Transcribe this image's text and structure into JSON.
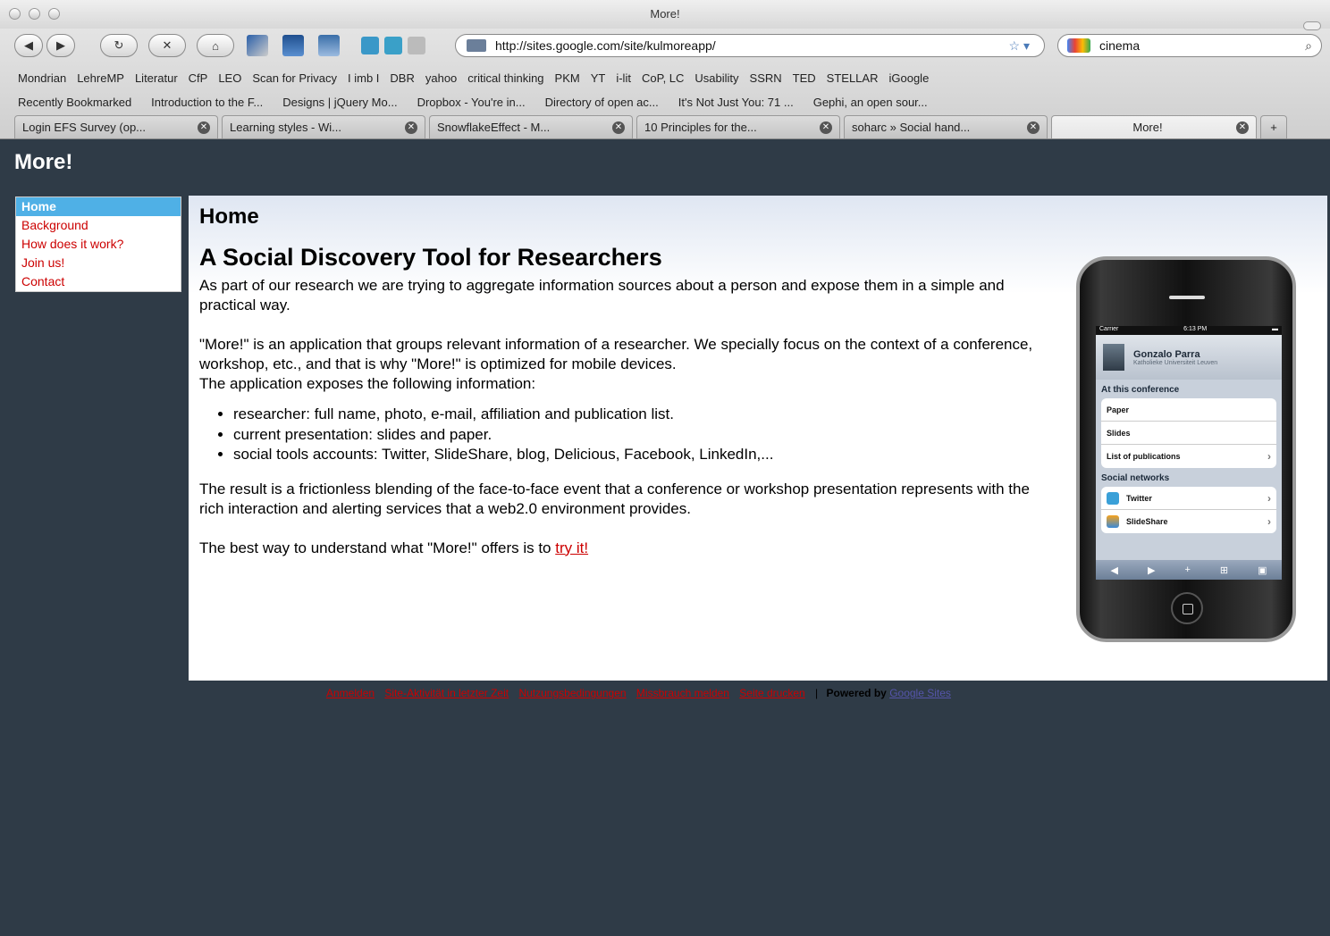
{
  "window": {
    "title": "More!"
  },
  "nav": {
    "url": "http://sites.google.com/site/kulmoreapp/",
    "search": "cinema"
  },
  "bookmarks": [
    "Mondrian",
    "LehreMP",
    "Literatur",
    "CfP",
    "LEO",
    "Scan for Privacy",
    "I imb I",
    "DBR",
    "yahoo",
    "critical thinking",
    "PKM",
    "YT",
    "i-lit",
    "CoP, LC",
    "Usability",
    "SSRN",
    "TED",
    "STELLAR",
    "iGoogle"
  ],
  "bookmarks2": [
    "Recently Bookmarked",
    "Introduction to the F...",
    "Designs | jQuery Mo...",
    "Dropbox - You're in...",
    "Directory of open ac...",
    "It's Not Just You: 71 ...",
    "Gephi, an open sour..."
  ],
  "tabs": [
    "Login EFS Survey (op...",
    "Learning styles - Wi...",
    "SnowflakeEffect - M...",
    "10 Principles for the...",
    "soharc » Social hand...",
    "More!"
  ],
  "site": {
    "title": "More!"
  },
  "sidebar": [
    "Home",
    "Background",
    "How does it work?",
    "Join us!",
    "Contact"
  ],
  "main": {
    "page_title": "Home",
    "heading": "A Social Discovery Tool for Researchers",
    "p1": "As part of our research we are trying to aggregate information sources about a person and expose them in a simple and practical way.",
    "p2a": "\"More!\" is an application that groups relevant information of a researcher. We specially focus on the context of a conference, workshop, etc., and that is why \"More!\" is optimized for mobile devices.",
    "p2b": "The application exposes the following information:",
    "bullets": [
      "researcher: full name, photo, e-mail, affiliation and publication list.",
      "current presentation: slides and paper.",
      "social tools accounts: Twitter, SlideShare, blog, Delicious, Facebook, LinkedIn,..."
    ],
    "p3": "The result is a frictionless blending of the face-to-face event that a conference or workshop presentation represents with the rich interaction and alerting services that a web2.0 environment provides.",
    "p4_prefix": "The best way to understand what \"More!\" offers is to ",
    "p4_link": "try it!"
  },
  "phone": {
    "carrier": "Carrier",
    "time": "6:13 PM",
    "name": "Gonzalo Parra",
    "affiliation": "Katholieke Universiteit Leuven",
    "section1": "At this conference",
    "rows1": [
      "Paper",
      "Slides",
      "List of publications"
    ],
    "section2": "Social networks",
    "rows2": [
      "Twitter",
      "SlideShare"
    ]
  },
  "footer": {
    "links": [
      "Anmelden",
      "Site-Aktivität in letzter Zeit",
      "Nutzungsbedingungen",
      "Missbrauch melden",
      "Seite drucken"
    ],
    "separator": "|",
    "powered": "Powered by",
    "google_sites": "Google Sites"
  },
  "colors": {
    "link": "#cc0000",
    "sidebar_active": "#4fb0e6",
    "background": "#2f3b47"
  }
}
